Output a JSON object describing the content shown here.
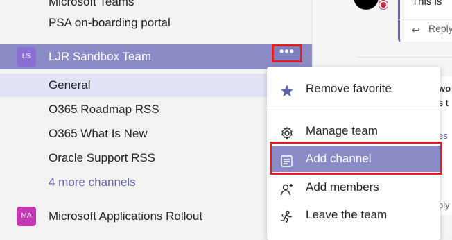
{
  "sidebar": {
    "items": [
      {
        "label": "Microsoft Teams",
        "type": "channel"
      },
      {
        "label": "PSA on-boarding portal",
        "type": "channel"
      },
      {
        "label": "LJR Sandbox Team",
        "type": "team",
        "avatar": "LS",
        "avatar_color": "#8b6fd6",
        "more_label": "•••"
      },
      {
        "label": "General",
        "type": "channel"
      },
      {
        "label": "O365 Roadmap RSS",
        "type": "channel"
      },
      {
        "label": "O365 What Is New",
        "type": "channel"
      },
      {
        "label": "Oracle Support RSS",
        "type": "channel"
      },
      {
        "label": "4 more channels",
        "type": "link"
      },
      {
        "label": "Microsoft Applications Rollout",
        "type": "team",
        "avatar": "MA",
        "avatar_color": "#c239b3"
      }
    ]
  },
  "context_menu": {
    "items": [
      {
        "label": "Remove favorite",
        "icon": "star-icon"
      },
      {
        "label": "Manage team",
        "icon": "gear-icon"
      },
      {
        "label": "Add channel",
        "icon": "channel-icon"
      },
      {
        "label": "Add members",
        "icon": "add-person-icon"
      },
      {
        "label": "Leave the team",
        "icon": "leave-icon"
      }
    ]
  },
  "conversation": {
    "message_fragment": "This is",
    "reply_label": "Reply",
    "fragment_bold": "wo",
    "fragment_text": "s t",
    "fragment_link": "es",
    "fragment_reply": "ply"
  },
  "colors": {
    "accent": "#6264a7",
    "active_team_bg": "#8b8cc7",
    "highlight_red": "#e02027"
  }
}
